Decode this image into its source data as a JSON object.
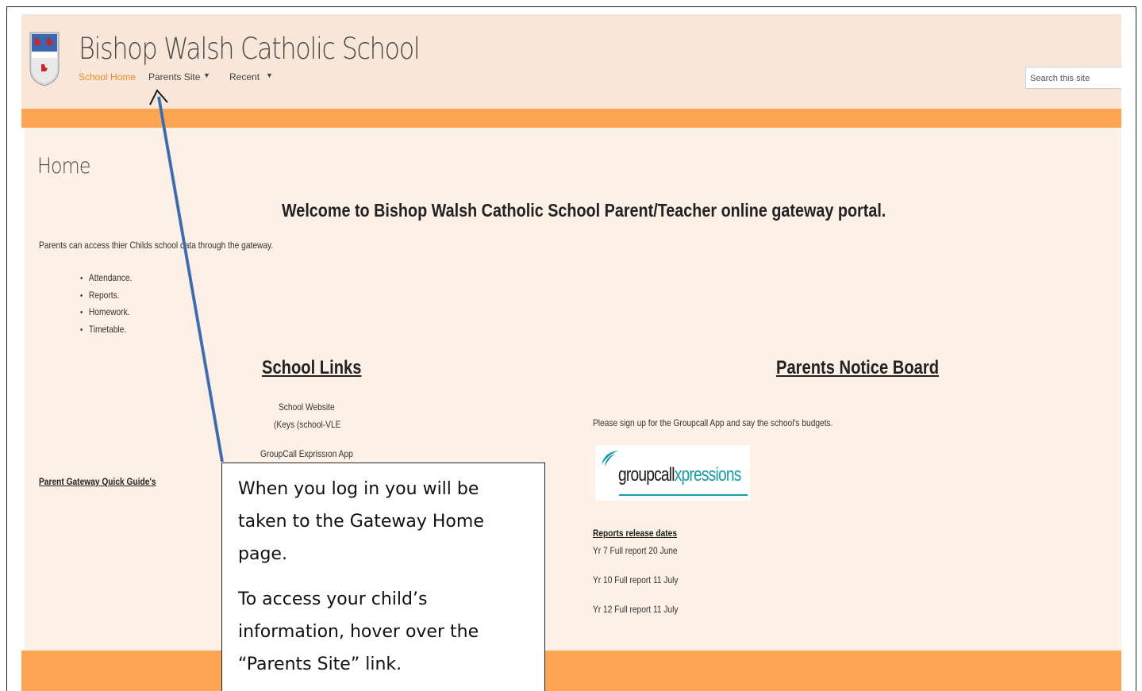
{
  "site": {
    "title": "Bishop Walsh Catholic School",
    "search_placeholder": "Search this site"
  },
  "nav": {
    "home": "School Home",
    "parents": "Parents Site",
    "recent": "Recent",
    "caret": "▼"
  },
  "page": {
    "title": "Home",
    "welcome": "Welcome to Bishop Walsh Catholic School Parent/Teacher online gateway portal.",
    "intro": "Parents can access thier Childs school data through the gateway.",
    "bullets": [
      "Attendance.",
      "Reports.",
      "Homework.",
      "Timetable."
    ]
  },
  "school_links": {
    "title": "School Links",
    "website": "School Website",
    "keys": "(Keys (school-VLE",
    "groupcall": "GroupCall Exprissıon App"
  },
  "quick_guide": "Parent Gateway Quick Guide's",
  "notice_board": {
    "title": "Parents Notice Board",
    "text": "Please sign up for the Groupcall App and say the school's budgets.",
    "logo_group": "groupcall",
    "logo_xp": "xpressions",
    "reports_title": "Reports release dates",
    "reports": [
      "Yr 7   Full report 20 June",
      "Yr 10 Full report 11 July",
      "Yr 12 Full report 11 July"
    ]
  },
  "callout": {
    "para1": "When you log in you will be taken to the Gateway Home page.",
    "para2": "To access your child’s information, hover over the “Parents Site” link."
  },
  "colors": {
    "accent_orange": "#fca553",
    "nav_active": "#f08a24",
    "background": "#fdf0e6",
    "arrow": "#4a7ab8"
  }
}
